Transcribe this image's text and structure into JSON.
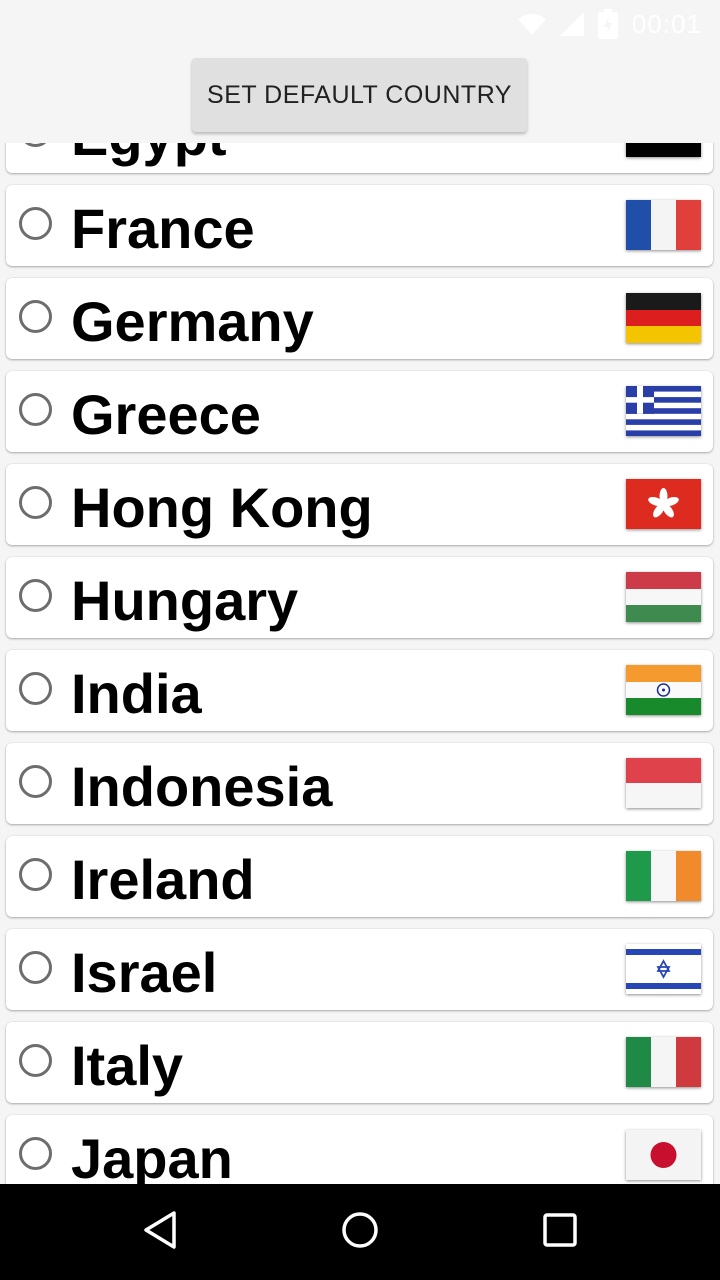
{
  "status_bar": {
    "time": "00:01"
  },
  "header": {
    "set_default_label": "SET DEFAULT COUNTRY"
  },
  "countries": [
    {
      "name": "Egypt",
      "flag": "egypt-flag"
    },
    {
      "name": "France",
      "flag": "france-flag"
    },
    {
      "name": "Germany",
      "flag": "germany-flag"
    },
    {
      "name": "Greece",
      "flag": "greece-flag"
    },
    {
      "name": "Hong Kong",
      "flag": "hong-kong-flag"
    },
    {
      "name": "Hungary",
      "flag": "hungary-flag"
    },
    {
      "name": "India",
      "flag": "india-flag"
    },
    {
      "name": "Indonesia",
      "flag": "indonesia-flag"
    },
    {
      "name": "Ireland",
      "flag": "ireland-flag"
    },
    {
      "name": "Israel",
      "flag": "israel-flag"
    },
    {
      "name": "Italy",
      "flag": "italy-flag"
    },
    {
      "name": "Japan",
      "flag": "japan-flag"
    }
  ],
  "nav_bar": {
    "buttons": [
      "back-icon",
      "home-icon",
      "recents-icon"
    ]
  }
}
